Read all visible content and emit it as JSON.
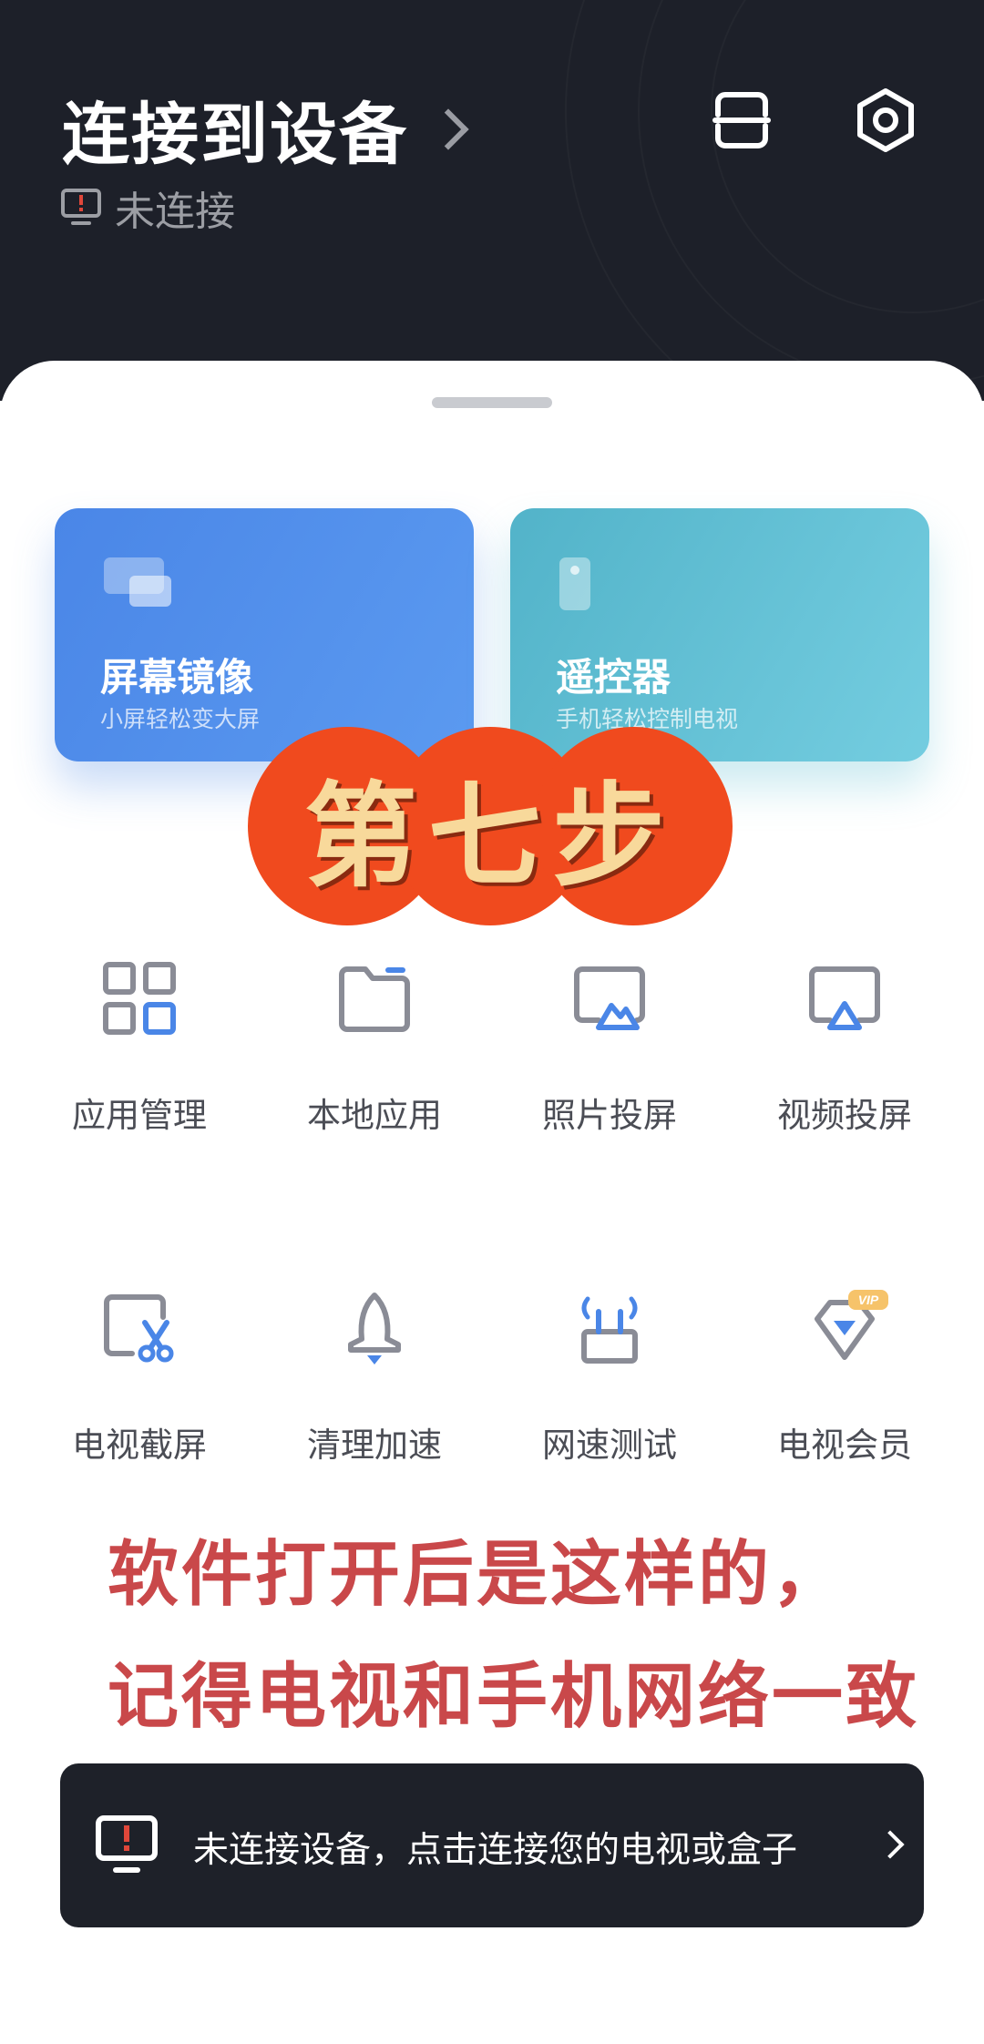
{
  "header": {
    "title": "连接到设备",
    "status": "未连接",
    "scan_icon": "scan-icon",
    "settings_icon": "gear-icon"
  },
  "cards": [
    {
      "title": "屏幕镜像",
      "subtitle": "小屏轻松变大屏",
      "icon": "screen-mirror-icon"
    },
    {
      "title": "遥控器",
      "subtitle": "手机轻松控制电视",
      "icon": "remote-icon"
    }
  ],
  "tools": [
    {
      "label": "应用管理",
      "icon": "app-grid-icon"
    },
    {
      "label": "本地应用",
      "icon": "folder-icon"
    },
    {
      "label": "照片投屏",
      "icon": "photo-cast-icon"
    },
    {
      "label": "视频投屏",
      "icon": "video-cast-icon"
    },
    {
      "label": "电视截屏",
      "icon": "screenshot-icon"
    },
    {
      "label": "清理加速",
      "icon": "rocket-icon"
    },
    {
      "label": "网速测试",
      "icon": "router-icon"
    },
    {
      "label": "电视会员",
      "icon": "diamond-icon",
      "badge": "VIP"
    }
  ],
  "overlay": {
    "step": "第七步",
    "caption_line1": "软件打开后是这样的，",
    "caption_line2": "记得电视和手机网络一致"
  },
  "bottom_bar": {
    "text": "未连接设备，点击连接您的电视或盒子"
  },
  "colors": {
    "header_bg": "#1d2029",
    "accent_blue": "#4a86e7",
    "accent_teal": "#5ab9cd",
    "icon_gray": "#8a8c96",
    "badge_orange": "#f25a22"
  }
}
